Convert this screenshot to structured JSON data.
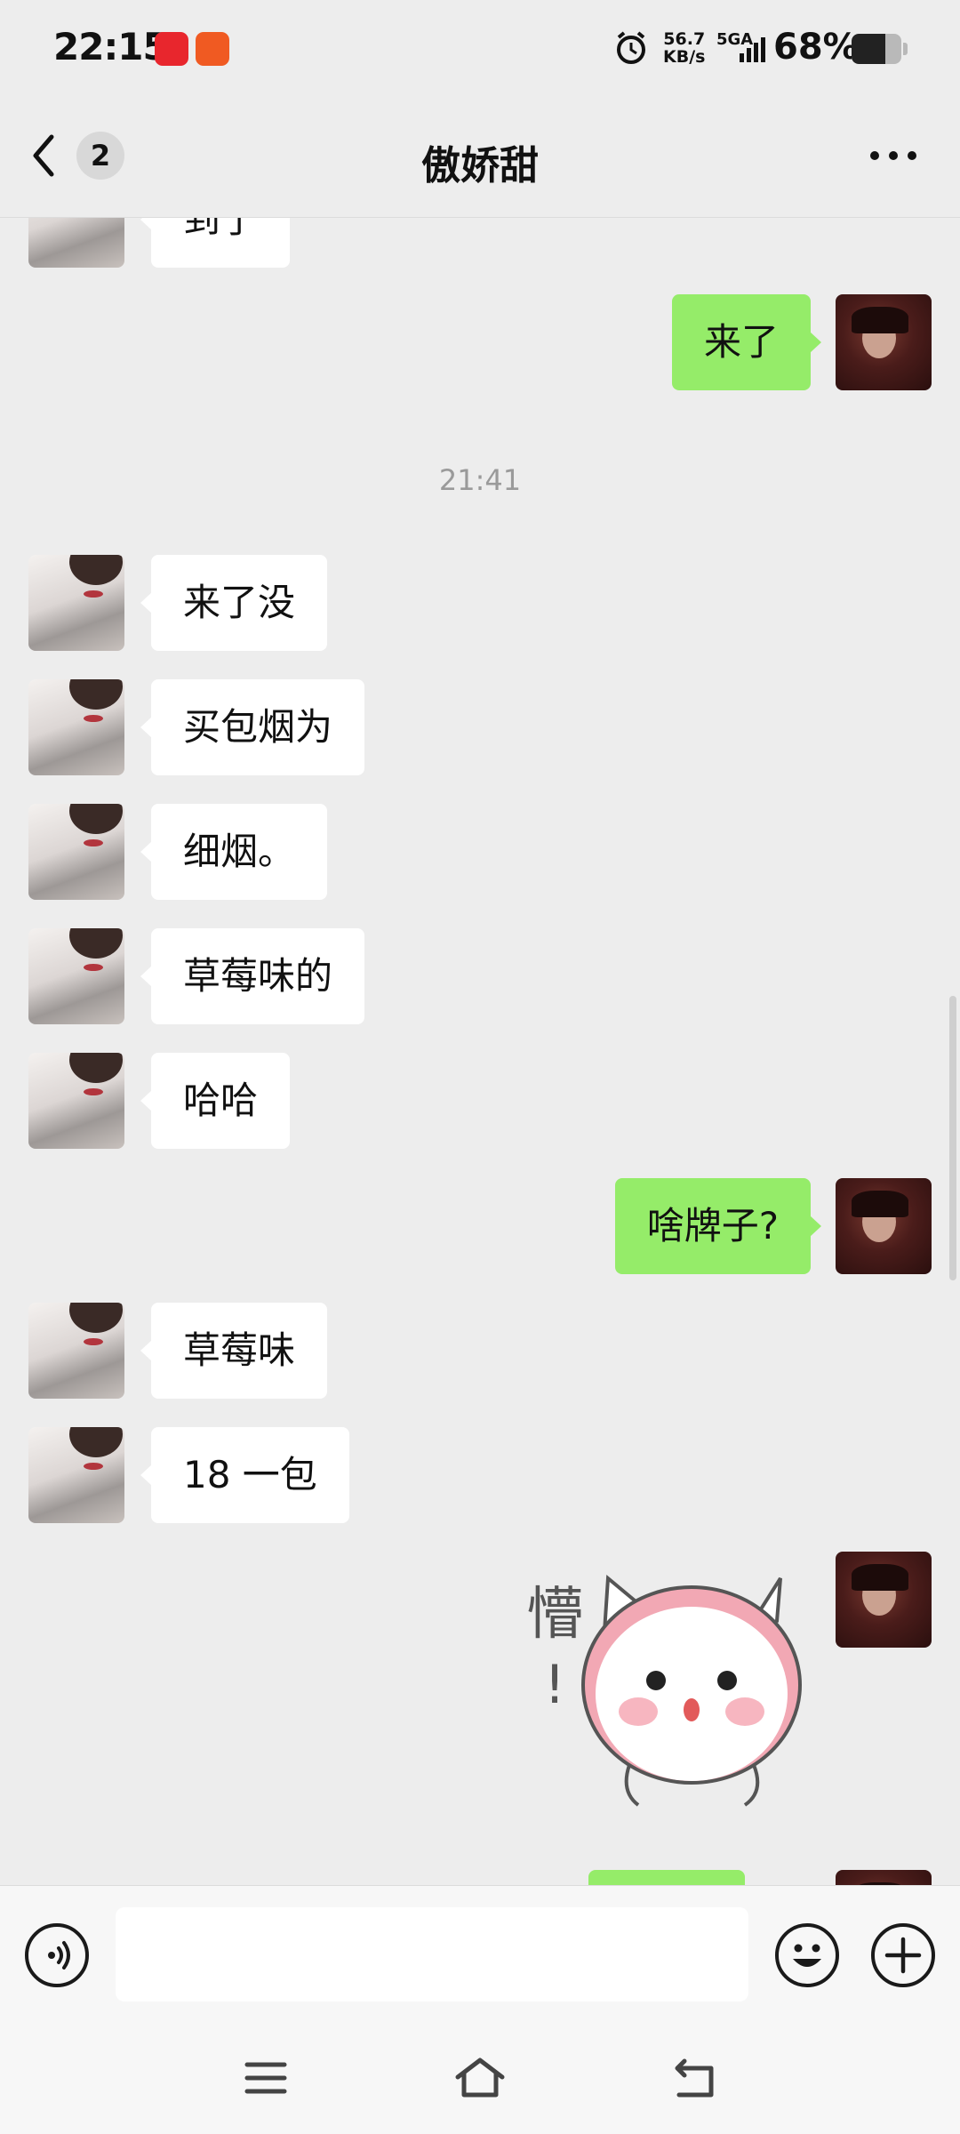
{
  "status_bar": {
    "time": "22:15",
    "net_speed_value": "56.7",
    "net_speed_unit": "KB/s",
    "network": "5GA",
    "battery": "68%",
    "battery_level": 0.68
  },
  "nav": {
    "back_badge": "2",
    "title": "傲娇甜"
  },
  "timestamp": "21:41",
  "messages": [
    {
      "from": "them",
      "text": "到了"
    },
    {
      "from": "me",
      "text": "来了"
    },
    {
      "from": "them",
      "text": "来了没"
    },
    {
      "from": "them",
      "text": "买包烟为"
    },
    {
      "from": "them",
      "text": "细烟。"
    },
    {
      "from": "them",
      "text": "草莓味的"
    },
    {
      "from": "them",
      "text": "哈哈"
    },
    {
      "from": "me",
      "text": "啥牌子?"
    },
    {
      "from": "them",
      "text": "草莓味"
    },
    {
      "from": "them",
      "text": "18 一包"
    },
    {
      "from": "me",
      "sticker": "懵!"
    }
  ],
  "sticker_text_1": "懵",
  "sticker_text_2": "!",
  "colors": {
    "background": "#ededed",
    "bubble_out": "#95ec69",
    "bubble_in": "#ffffff"
  }
}
